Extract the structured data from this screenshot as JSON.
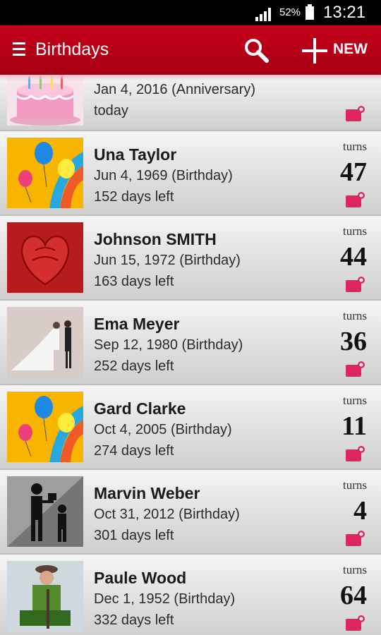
{
  "status": {
    "battery": "52%",
    "time": "13:21"
  },
  "appbar": {
    "title": "Birthdays",
    "new_label": "NEW"
  },
  "rows": [
    {
      "name": "",
      "date": "Jan 4, 2016 (Anniversary)",
      "left": "today",
      "turns": "",
      "age": "",
      "thumb": "cake"
    },
    {
      "name": "Una Taylor",
      "date": "Jun 4, 1969 (Birthday)",
      "left": "152 days left",
      "turns": "turns",
      "age": "47",
      "thumb": "balloons"
    },
    {
      "name": "Johnson SMITH",
      "date": "Jun 15, 1972 (Birthday)",
      "left": "163 days left",
      "turns": "turns",
      "age": "44",
      "thumb": "heart"
    },
    {
      "name": "Ema Meyer",
      "date": "Sep 12, 1980 (Birthday)",
      "left": "252 days left",
      "turns": "turns",
      "age": "36",
      "thumb": "wedding"
    },
    {
      "name": "Gard Clarke",
      "date": "Oct 4, 2005 (Birthday)",
      "left": "274 days left",
      "turns": "turns",
      "age": "11",
      "thumb": "balloons"
    },
    {
      "name": "Marvin Weber",
      "date": "Oct 31, 2012 (Birthday)",
      "left": "301 days left",
      "turns": "turns",
      "age": "4",
      "thumb": "gift-people"
    },
    {
      "name": "Paule Wood",
      "date": "Dec 1, 1952 (Birthday)",
      "left": "332 days left",
      "turns": "turns",
      "age": "64",
      "thumb": "old-man"
    }
  ],
  "colors": {
    "appbar": "#b0001a",
    "accent_pink": "#e0245e"
  }
}
